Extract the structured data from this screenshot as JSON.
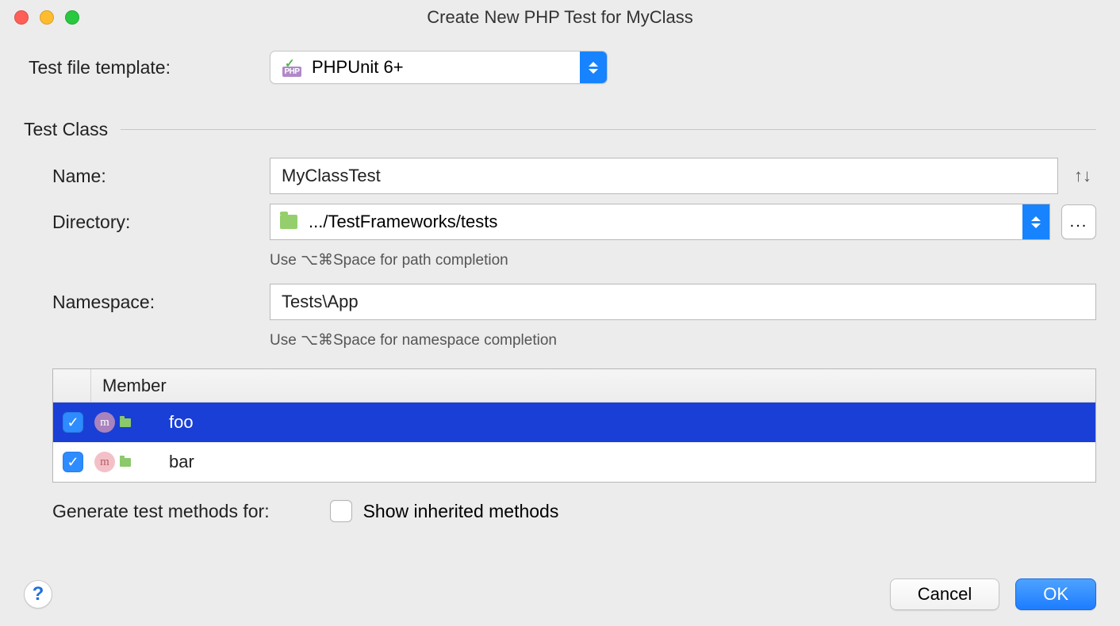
{
  "window": {
    "title": "Create New PHP Test for MyClass"
  },
  "template": {
    "label": "Test file template:",
    "value": "PHPUnit 6+"
  },
  "fieldset": {
    "legend": "Test Class"
  },
  "name": {
    "label": "Name:",
    "value": "MyClassTest"
  },
  "directory": {
    "label": "Directory:",
    "value": ".../TestFrameworks/tests",
    "hint": "Use ⌥⌘Space for path completion",
    "button": "..."
  },
  "namespace": {
    "label": "Namespace:",
    "value": "Tests\\App",
    "hint": "Use ⌥⌘Space for namespace completion"
  },
  "table": {
    "header": "Member",
    "rows": [
      {
        "name": "foo",
        "checked": true,
        "selected": true
      },
      {
        "name": "bar",
        "checked": true,
        "selected": false
      }
    ]
  },
  "generate": {
    "label": "Generate test methods for:",
    "inherited_label": "Show inherited methods",
    "inherited_checked": false
  },
  "buttons": {
    "cancel": "Cancel",
    "ok": "OK",
    "help": "?"
  },
  "sort_icon": "↑↓"
}
